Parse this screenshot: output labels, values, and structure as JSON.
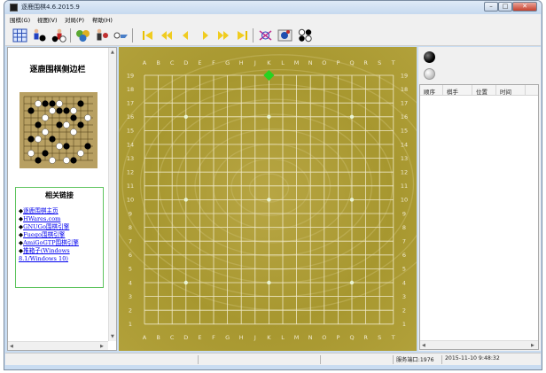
{
  "window": {
    "title": "逐鹿围棋4.6.2015.9",
    "minimize": "–",
    "maximize": "□",
    "close": "✕"
  },
  "menu": [
    {
      "label": "围棋(G)"
    },
    {
      "label": "视图(V)"
    },
    {
      "label": "对局(P)"
    },
    {
      "label": "帮助(H)"
    }
  ],
  "toolbar": {
    "icons": [
      "board-grid-icon",
      "human-vs-computer-icon",
      "computer-vs-human-icon",
      "network-play-icon",
      "human-vs-human-icon",
      "options-icon",
      "first-move-icon",
      "back-ten-icon",
      "back-one-icon",
      "forward-one-icon",
      "forward-ten-icon",
      "last-move-icon",
      "analysis-icon",
      "join-game-icon",
      "stone-set-icon"
    ]
  },
  "sidebar": {
    "title": "逐鹿围棋侧边栏",
    "links_title": "相关链接",
    "links": [
      {
        "label": "逐鹿围棋主页"
      },
      {
        "label": "HWares.com"
      },
      {
        "label": "GNUGo围棋引擎"
      },
      {
        "label": "Fuego围棋引擎"
      },
      {
        "label": "AmiGoGTP围棋引擎"
      },
      {
        "label": "推箱子(Windows 8.1/Windows 10)"
      }
    ]
  },
  "board": {
    "columns": [
      "A",
      "B",
      "C",
      "D",
      "E",
      "F",
      "G",
      "H",
      "J",
      "K",
      "L",
      "M",
      "N",
      "O",
      "P",
      "Q",
      "R",
      "S",
      "T"
    ],
    "rows": [
      "19",
      "18",
      "17",
      "16",
      "15",
      "14",
      "13",
      "12",
      "11",
      "10",
      "9",
      "8",
      "7",
      "6",
      "5",
      "4",
      "3",
      "2",
      "1"
    ],
    "star_points": [
      [
        "D",
        "16"
      ],
      [
        "K",
        "16"
      ],
      [
        "Q",
        "16"
      ],
      [
        "D",
        "10"
      ],
      [
        "K",
        "10"
      ],
      [
        "Q",
        "10"
      ],
      [
        "D",
        "4"
      ],
      [
        "K",
        "4"
      ],
      [
        "Q",
        "4"
      ]
    ],
    "cursor": {
      "col": "K",
      "row": "19"
    },
    "colors": {
      "wood": "#aa9a35",
      "line": "#efe9c8",
      "label": "#f1ead0",
      "cursor": "#27d321"
    }
  },
  "right_panel": {
    "current_player": "black",
    "columns": [
      "顺序",
      "棋手",
      "位置",
      "时间"
    ]
  },
  "status": {
    "port_label": "服务端口:1976",
    "datetime": "2015-11-10 9:48:32"
  }
}
